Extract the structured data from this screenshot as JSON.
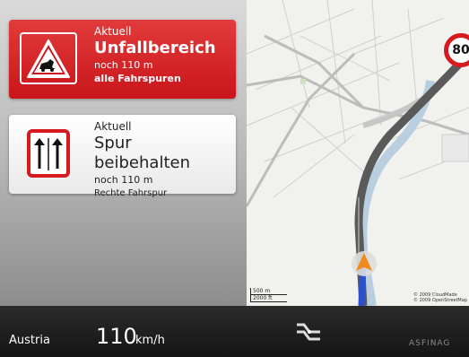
{
  "warning": {
    "label": "Aktuell",
    "title": "Unfallbereich",
    "distance": "noch 110 m",
    "detail": "alle Fahrspuren",
    "icon": "accident-warning-icon",
    "color": "#d4161c"
  },
  "lane": {
    "label": "Aktuell",
    "title": "Spur beibehalten",
    "distance": "noch 110 m",
    "detail": "Rechte Fahrspur",
    "icon": "keep-lane-icon"
  },
  "map": {
    "speed_limit": "80",
    "scale_top": "500 m",
    "scale_bottom": "2000 ft",
    "attribution_1": "© 2009 CloudMade",
    "attribution_2": "© 2009 OpenStreetMap"
  },
  "status_bar": {
    "country": "Austria",
    "speed": "110",
    "unit": "km/h",
    "route_icon": "route-icon",
    "brand": "ASFINAG"
  }
}
